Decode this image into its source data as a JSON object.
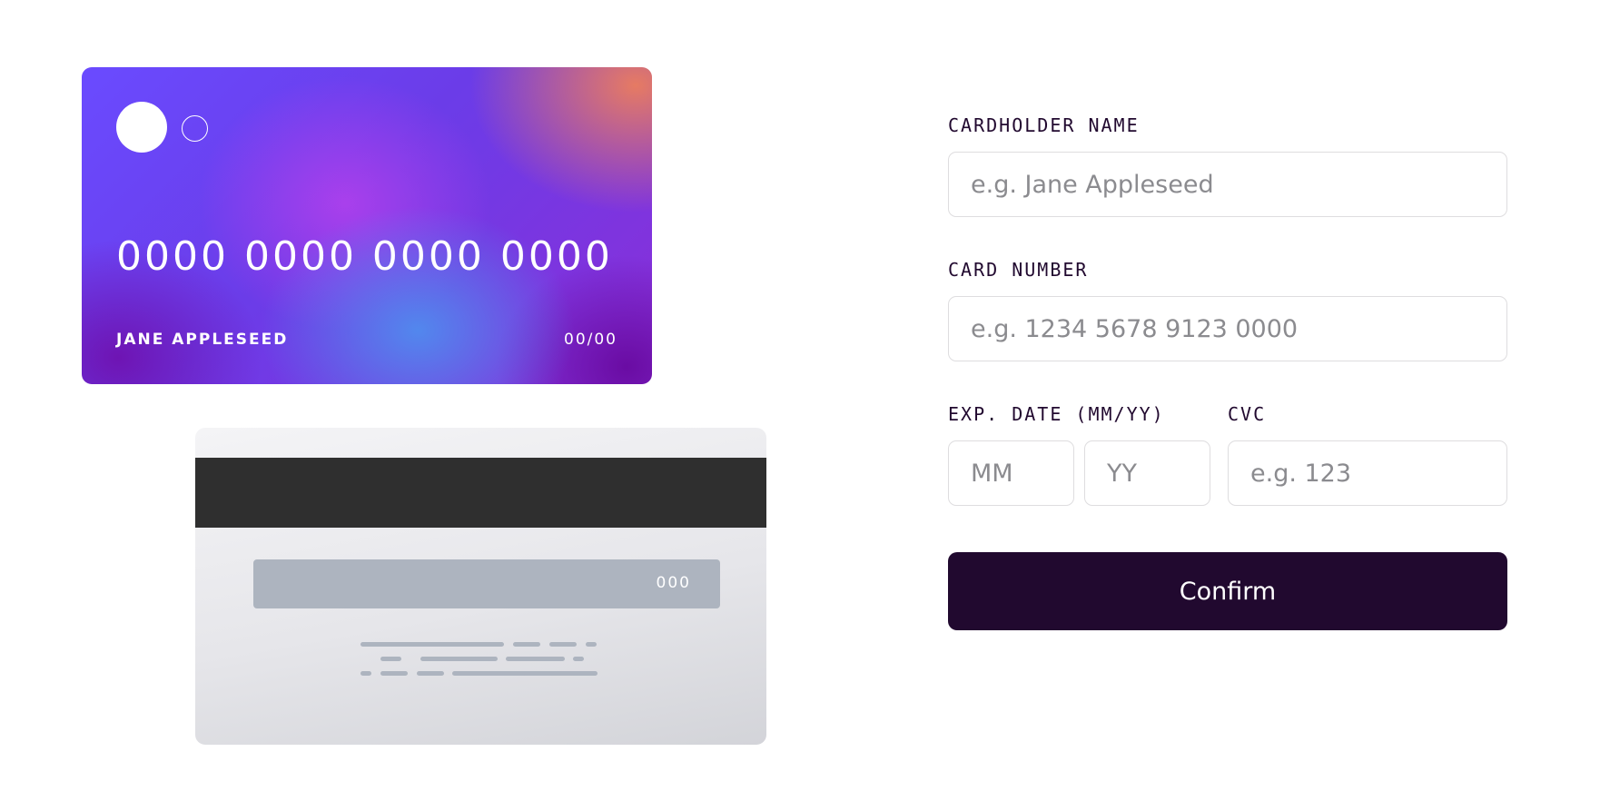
{
  "card_front": {
    "number": "0000 0000 0000 0000",
    "name": "JANE APPLESEED",
    "expiry": "00/00"
  },
  "card_back": {
    "cvc": "000"
  },
  "form": {
    "cardholder": {
      "label": "CARDHOLDER NAME",
      "placeholder": "e.g. Jane Appleseed"
    },
    "number": {
      "label": "CARD NUMBER",
      "placeholder": "e.g. 1234 5678 9123 0000"
    },
    "expiry": {
      "label": "EXP. DATE (MM/YY)",
      "month_placeholder": "MM",
      "year_placeholder": "YY"
    },
    "cvc": {
      "label": "CVC",
      "placeholder": "e.g. 123"
    },
    "confirm_label": "Confirm"
  },
  "colors": {
    "dark_violet": "#21092f",
    "input_border": "#dedddf",
    "placeholder": "#8b8b8f",
    "mag_strip": "#2f2f2f",
    "signature_panel": "#adb4bf"
  }
}
